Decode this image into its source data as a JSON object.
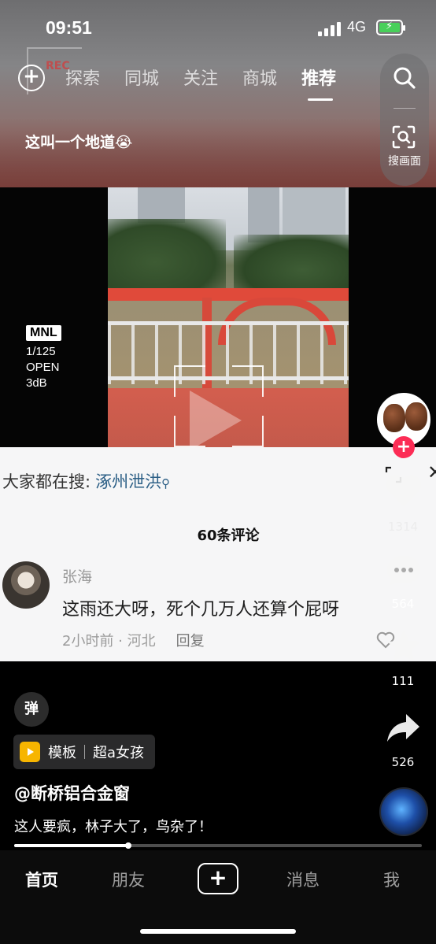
{
  "status_bar": {
    "time": "09:51",
    "network": "4G"
  },
  "top_nav": {
    "tabs": [
      "探索",
      "同城",
      "关注",
      "商城",
      "推荐"
    ],
    "active_tab": "推荐",
    "overlay_text": "REC",
    "search_screen_label": "搜画面"
  },
  "video": {
    "caption": "这叫一个地道😭",
    "camera": {
      "mode": "MNL",
      "shutter": "1/125",
      "aperture": "OPEN",
      "gain": "3dB"
    }
  },
  "comment_panel": {
    "search_prefix": "大家都在搜:",
    "search_keyword": "涿州泄洪",
    "comment_count_label": "60条评论",
    "comment": {
      "username": "张海",
      "text": "这雨还大呀，死个几万人还算个屁呀",
      "time_location": "2小时前 · 河北",
      "reply_label": "回复"
    }
  },
  "actions": {
    "likes": "1314",
    "comments": "564",
    "favorites": "111",
    "shares": "526"
  },
  "bottom_info": {
    "danmu_label": "弹",
    "template_label": "模板",
    "template_name": "超a女孩",
    "author": "@断桥铝合金窗",
    "description": "这人要疯，林子大了，鸟杂了！",
    "progress_fraction": 0.28
  },
  "tab_bar": {
    "items": [
      "首页",
      "朋友",
      "消息",
      "我"
    ],
    "active": "首页"
  },
  "colors": {
    "follow_accent": "#fc2c55",
    "link_keyword": "#2c5f86",
    "template_icon": "#f7b500",
    "battery": "#48d05a"
  }
}
